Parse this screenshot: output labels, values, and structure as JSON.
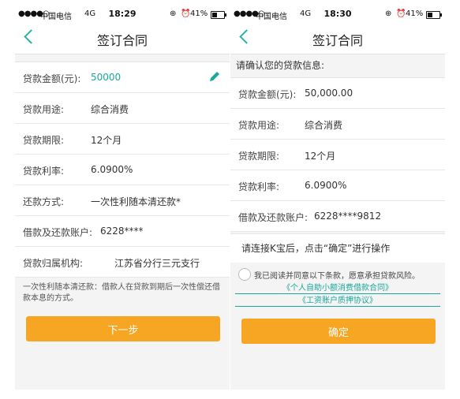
{
  "left": {
    "status": {
      "signal": "●●●●○",
      "carrier": "中国电信",
      "network": "4G",
      "time": "18:29",
      "battery": "41%"
    },
    "title": "签订合同",
    "fields": [
      {
        "label": "贷款金额(元):",
        "value": "50000"
      },
      {
        "label": "贷款用途:",
        "value": "综合消费"
      },
      {
        "label": "贷款期限:",
        "value": "12个月"
      },
      {
        "label": "贷款利率:",
        "value": "6.0900%"
      },
      {
        "label": "还款方式:",
        "value": "一次性利随本清还款*"
      },
      {
        "label": "借款及还款账户:",
        "value": "6228****"
      },
      {
        "label": "贷款归属机构:",
        "value": "江苏省分行三元支行"
      }
    ],
    "footnote": "一次性利随本清还款：借款人在贷款到期后一次性偿还借款本息的方式。",
    "next_button": "下一步"
  },
  "right": {
    "status": {
      "signal": "●●●●○",
      "carrier": "中国电信",
      "network": "4G",
      "time": "18:30",
      "battery": "41%"
    },
    "title": "签订合同",
    "intro": "请确认您的贷款信息:",
    "fields": [
      {
        "label": "贷款金额(元):",
        "value": "50,000.00"
      },
      {
        "label": "贷款用途:",
        "value": "综合消费"
      },
      {
        "label": "贷款期限:",
        "value": "12个月"
      },
      {
        "label": "贷款利率:",
        "value": "6.0900%"
      },
      {
        "label": "借款及还款账户:",
        "value": "6228****9812"
      }
    ],
    "instruction": "请连接K宝后，点击“确定”进行操作",
    "agreement_text": "我已阅读并同意以下条款，愿意承担贷款风险。",
    "links": [
      "《个人自助小额消费借款合同》",
      "《工资账户质押协议》"
    ],
    "confirm_button": "确定"
  },
  "colors": {
    "accent": "#1aa89c",
    "button": "#f6a623"
  },
  "icons": {
    "back": "chevron-left-icon",
    "edit": "pencil-icon",
    "alarm": "alarm-icon",
    "lock": "rotation-lock-icon"
  }
}
